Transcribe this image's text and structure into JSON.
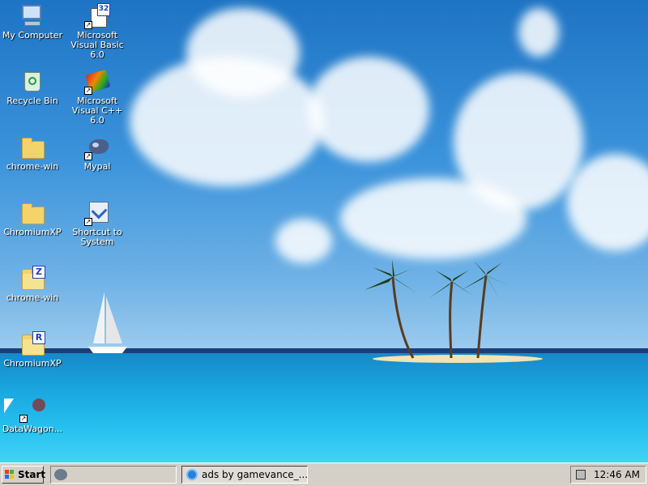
{
  "desktop": {
    "icons": [
      {
        "label": "My Computer",
        "icon": "my-computer-icon"
      },
      {
        "label": "Microsoft Visual Basic 6.0",
        "icon": "visual-basic-icon",
        "badge": "32"
      },
      {
        "label": "Recycle Bin",
        "icon": "recycle-bin-icon"
      },
      {
        "label": "Microsoft Visual C++ 6.0",
        "icon": "visual-cpp-icon"
      },
      {
        "label": "chrome-win",
        "icon": "folder-icon"
      },
      {
        "label": "Mypal",
        "icon": "mypal-icon"
      },
      {
        "label": "ChromiumXP",
        "icon": "folder-icon"
      },
      {
        "label": "Shortcut to System",
        "icon": "system-shortcut-icon"
      },
      {
        "label": "chrome-win",
        "icon": "zip-folder-icon",
        "badge": "Z"
      },
      {
        "label": "ChromiumXP",
        "icon": "rar-folder-icon",
        "badge": "R"
      },
      {
        "label": "DataWagon...",
        "icon": "datawagon-icon"
      }
    ]
  },
  "taskbar": {
    "start_label": "Start",
    "quicklaunch_icon": "quick-launch-icon",
    "task_buttons": [
      {
        "label": "ads by gamevance_...",
        "icon": "internet-explorer-icon"
      }
    ],
    "tray_icon": "tray-icon",
    "clock": "12:46 AM"
  },
  "colors": {
    "taskbar_bg": "#d4d0c8",
    "sky": "#2b86d6",
    "sea": "#1aa7e0",
    "folder": "#f4d36b"
  }
}
